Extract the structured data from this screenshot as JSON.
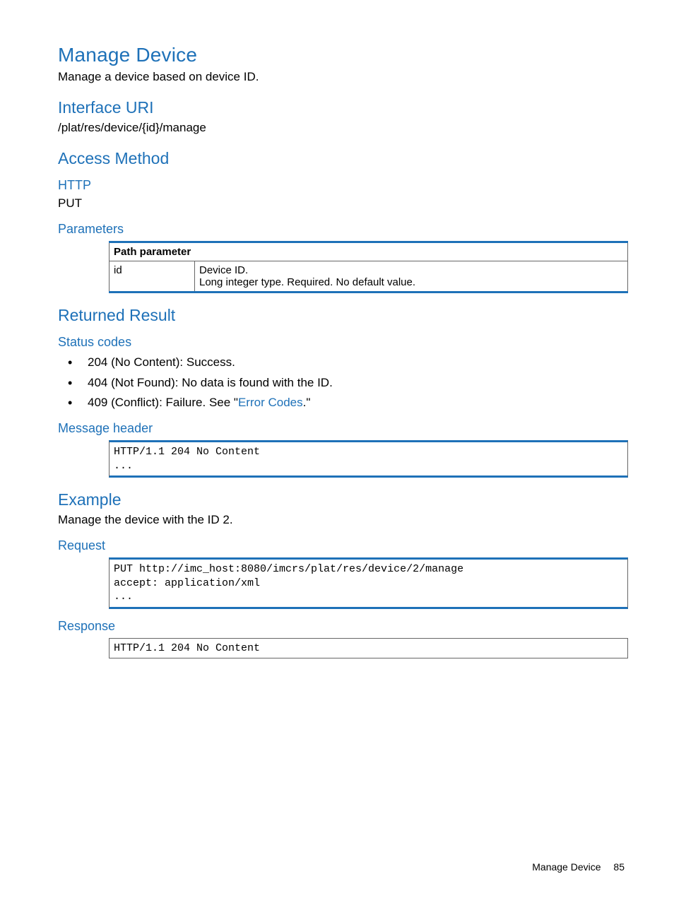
{
  "title": "Manage Device",
  "intro": "Manage a device based on device ID.",
  "interface_uri": {
    "heading": "Interface URI",
    "value": "/plat/res/device/{id}/manage"
  },
  "access_method": {
    "heading": "Access Method",
    "http_heading": "HTTP",
    "http_value": "PUT",
    "parameters_heading": "Parameters",
    "table": {
      "header": "Path parameter",
      "rows": [
        {
          "name": "id",
          "desc1": "Device ID.",
          "desc2": "Long integer type. Required. No default value."
        }
      ]
    }
  },
  "returned_result": {
    "heading": "Returned Result",
    "status_codes_heading": "Status codes",
    "status_codes": [
      "204 (No Content): Success.",
      "404 (Not Found): No data is found with the ID."
    ],
    "status_code_409_prefix": "409 (Conflict): Failure. See \"",
    "status_code_409_link": "Error Codes",
    "status_code_409_suffix": ".\"",
    "message_header_heading": "Message header",
    "message_header_code": "HTTP/1.1 204 No Content\n..."
  },
  "example": {
    "heading": "Example",
    "intro": "Manage the device with the ID 2.",
    "request_heading": "Request",
    "request_code": "PUT http://imc_host:8080/imcrs/plat/res/device/2/manage\naccept: application/xml\n...",
    "response_heading": "Response",
    "response_code": "HTTP/1.1 204 No Content"
  },
  "footer": {
    "label": "Manage Device",
    "page": "85"
  }
}
